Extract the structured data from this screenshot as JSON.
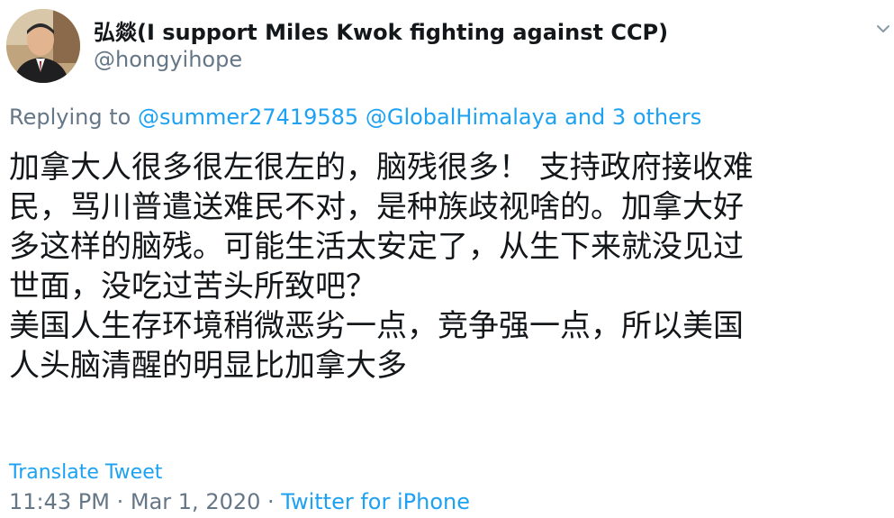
{
  "user": {
    "display_name": "弘燚(I support Miles Kwok fighting against CCP)",
    "handle": "@hongyihope"
  },
  "reply": {
    "prefix": "Replying to ",
    "mention_1": "@summer27419585",
    "mention_2": "@GlobalHimalaya",
    "others": "and 3 others"
  },
  "tweet": {
    "lines": [
      "加拿大人很多很左很左的，脑残很多！ 支持政府接收难",
      "民，骂川普遣送难民不对，是种族歧视啥的。加拿大好",
      "多这样的脑残。可能生活太安定了，从生下来就没见过",
      "世面，没吃过苦头所致吧？",
      "美国人生存环境稍微恶劣一点，竞争强一点，所以美国",
      "人头脑清醒的明显比加拿大多"
    ]
  },
  "translate_label": "Translate Tweet",
  "meta": {
    "time": "11:43 PM",
    "separator": " · ",
    "date": "Mar 1, 2020",
    "source": "Twitter for iPhone"
  },
  "colors": {
    "link": "#1da1f2",
    "secondary_text": "#657786",
    "primary_text": "#14171a"
  },
  "icons": {
    "caret": "chevron-down-icon",
    "avatar": "avatar-photo"
  }
}
